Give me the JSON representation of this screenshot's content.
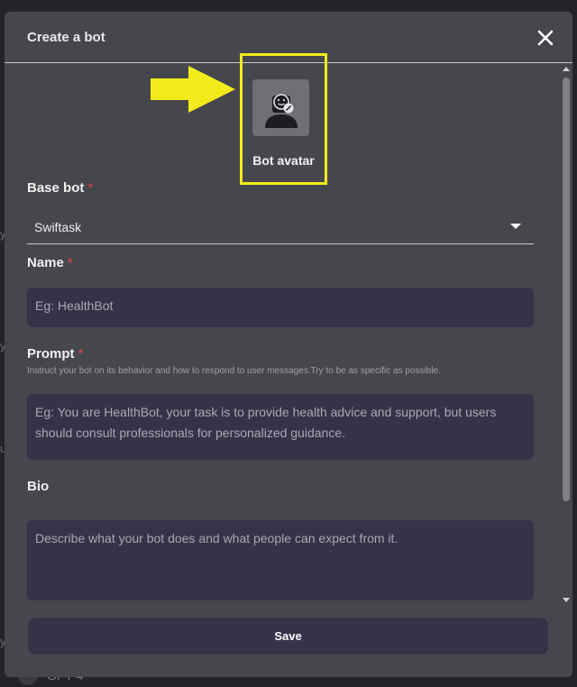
{
  "dialog": {
    "title": "Create a bot",
    "avatar_label": "Bot avatar",
    "base_bot": {
      "label": "Base bot",
      "required_mark": "*",
      "value": "Swiftask"
    },
    "name": {
      "label": "Name",
      "required_mark": "*",
      "placeholder": "Eg: HealthBot"
    },
    "prompt": {
      "label": "Prompt",
      "required_mark": "*",
      "helper": "Instruct your bot on its behavior and how to respond to user messages.Try to be as specific as possible.",
      "placeholder": "Eg: You are HealthBot, your task is to provide health advice and support, but users should consult professionals for personalized guidance."
    },
    "bio": {
      "label": "Bio",
      "placeholder": "Describe what your bot does and what people can expect from it."
    },
    "save_label": "Save"
  },
  "background": {
    "bottom_text": "GPT-4"
  },
  "icons": {
    "close": "close-icon",
    "avatar": "bot-avatar-edit-icon",
    "caret": "caret-down-icon",
    "arrow": "arrow-right-icon"
  },
  "colors": {
    "highlight": "#f3ec1a",
    "required": "#e0474c",
    "input_bg": "#363349",
    "modal_bg": "#46474c"
  }
}
